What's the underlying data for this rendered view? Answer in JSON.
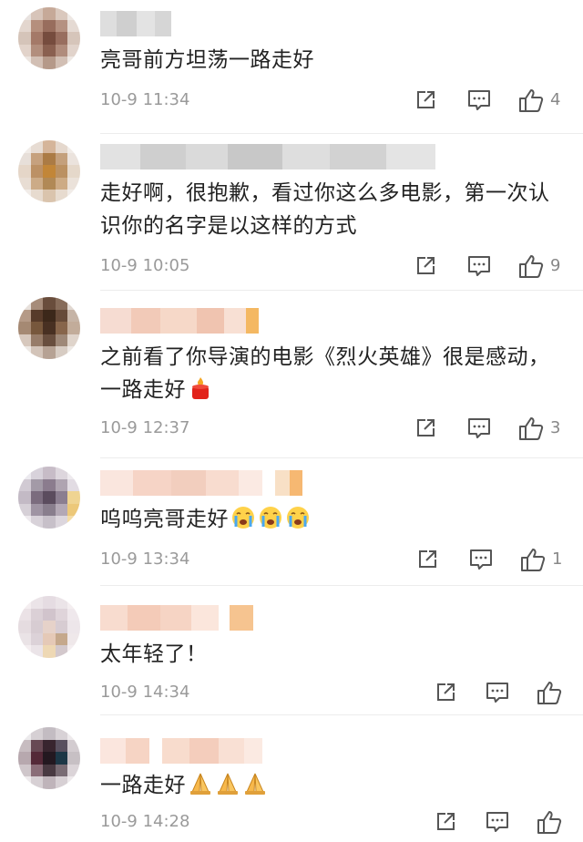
{
  "comments": [
    {
      "text": "亮哥前方坦荡一路走好",
      "time": "10-9 11:34",
      "likes": "4"
    },
    {
      "text": "走好啊，很抱歉，看过你这么多电影，第一次认识你的名字是以这样的方式",
      "time": "10-9 10:05",
      "likes": "9"
    },
    {
      "text": "之前看了你导演的电影《烈火英雄》很是感动，一路走好",
      "time": "10-9 12:37",
      "likes": "3"
    },
    {
      "text": "呜呜亮哥走好",
      "time": "10-9 13:34",
      "likes": "1"
    },
    {
      "text": "太年轻了！",
      "time": "10-9 14:34",
      "likes": ""
    },
    {
      "text": "一路走好",
      "time": "10-9 14:28",
      "likes": ""
    }
  ],
  "icons": {
    "repost": "share-icon",
    "reply": "comment-icon",
    "like": "thumbs-up-icon",
    "candle": "candle-emoji",
    "crying": "crying-emoji",
    "pray": "pray-emoji"
  }
}
